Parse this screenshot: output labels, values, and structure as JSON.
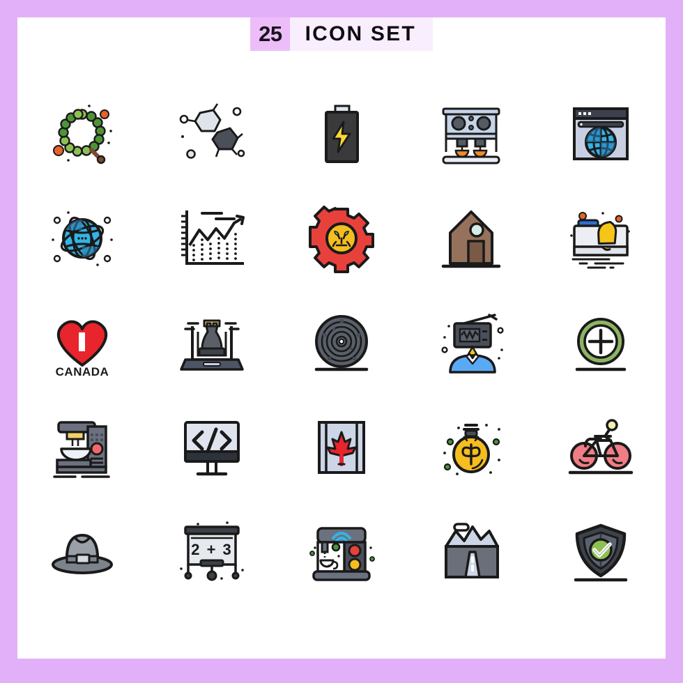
{
  "page": {
    "outer_background": "#e2b0f9",
    "sheet_background": "#ffffff"
  },
  "header": {
    "count": "25",
    "title": "ICON SET",
    "count_background": "#edbdfa",
    "title_background": "#f8eefd",
    "text_color": "#14101a"
  },
  "grid": {
    "columns": 5,
    "rows": 5,
    "total_icons": 25,
    "icons": [
      {
        "id": "prayer-beads",
        "label": "Prayer Beads",
        "row": 1,
        "col": 1,
        "colors": [
          "#4e9437",
          "#8cc152",
          "#e8622a",
          "#7a4a32"
        ]
      },
      {
        "id": "molecule",
        "label": "Molecule",
        "row": 1,
        "col": 2,
        "colors": [
          "#dfe4ea",
          "#4b5058",
          "#1a1a1a"
        ]
      },
      {
        "id": "battery-charging",
        "label": "Battery Charging",
        "row": 1,
        "col": 3,
        "colors": [
          "#3a3a3c",
          "#fbd734",
          "#dfe6f2"
        ]
      },
      {
        "id": "espresso-machine",
        "label": "Espresso Machine",
        "row": 1,
        "col": 4,
        "colors": [
          "#c6d4e8",
          "#555b63",
          "#f08b2a"
        ]
      },
      {
        "id": "web-browser-globe",
        "label": "Web Browser",
        "row": 1,
        "col": 5,
        "colors": [
          "#3c414d",
          "#c9cfe3",
          "#33b4e5",
          "#2a7fb8"
        ]
      },
      {
        "id": "global-network",
        "label": "Global Network",
        "row": 2,
        "col": 1,
        "colors": [
          "#33b4e5",
          "#2f79a8",
          "#1a1a1a"
        ]
      },
      {
        "id": "growth-chart",
        "label": "Growth Chart",
        "row": 2,
        "col": 2,
        "colors": [
          "#1a1a1a"
        ]
      },
      {
        "id": "settings-lion",
        "label": "Settings Gear",
        "row": 2,
        "col": 3,
        "colors": [
          "#e8413c",
          "#f5bd1f",
          "#8cc152"
        ]
      },
      {
        "id": "barn-house",
        "label": "Barn House",
        "row": 2,
        "col": 4,
        "colors": [
          "#96725c",
          "#7a5a46",
          "#d6ece8"
        ]
      },
      {
        "id": "notification-screen",
        "label": "Notification Alert",
        "row": 2,
        "col": 5,
        "colors": [
          "#2f6fd0",
          "#eceef3",
          "#f5c518",
          "#e8622a"
        ]
      },
      {
        "id": "i-love-canada",
        "label": "I Love Canada",
        "row": 3,
        "col": 1,
        "colors": [
          "#e8242c",
          "#1a1a1a"
        ]
      },
      {
        "id": "chess-laptop",
        "label": "Chess Strategy Laptop",
        "row": 3,
        "col": 2,
        "colors": [
          "#5a5f68",
          "#3e434c",
          "#f5d06a",
          "#4d5566"
        ]
      },
      {
        "id": "labyrinth-disc",
        "label": "Labyrinth Disc",
        "row": 3,
        "col": 3,
        "colors": [
          "#5a606a",
          "#464b54"
        ]
      },
      {
        "id": "radio-head-person",
        "label": "Radio Person",
        "row": 3,
        "col": 4,
        "colors": [
          "#4a4f59",
          "#5aa9f5",
          "#ffffff"
        ]
      },
      {
        "id": "add-circle",
        "label": "Add Circle",
        "row": 3,
        "col": 5,
        "colors": [
          "#8cb462",
          "#1a1a1a"
        ]
      },
      {
        "id": "stand-mixer",
        "label": "Stand Mixer",
        "row": 4,
        "col": 1,
        "colors": [
          "#6c717f",
          "#eef1f7",
          "#f5d06a",
          "#f4676b"
        ]
      },
      {
        "id": "code-monitor",
        "label": "Code Monitor",
        "row": 4,
        "col": 2,
        "colors": [
          "#dfe4ee",
          "#2e323a",
          "#1a1a1a"
        ]
      },
      {
        "id": "canada-flag",
        "label": "Canada Flag",
        "row": 4,
        "col": 3,
        "colors": [
          "#cdd6e6",
          "#e8242c",
          "#1a1a1a"
        ]
      },
      {
        "id": "idea-money-bulb",
        "label": "Money Idea Bulb",
        "row": 4,
        "col": 4,
        "colors": [
          "#f5bd1f",
          "#4e9437",
          "#1a1a1a"
        ]
      },
      {
        "id": "bicycle",
        "label": "Bicycle",
        "row": 4,
        "col": 5,
        "colors": [
          "#f07d85",
          "#f5eeb0",
          "#1a1a1a"
        ]
      },
      {
        "id": "fedora-hat",
        "label": "Fedora Hat",
        "row": 5,
        "col": 1,
        "colors": [
          "#9aa0a8",
          "#7d838c",
          "#d7dbe1"
        ]
      },
      {
        "id": "math-whiteboard",
        "label": "Math Whiteboard",
        "row": 5,
        "col": 2,
        "colors": [
          "#e6e9ee",
          "#3c4047",
          "#1a1a1a"
        ],
        "text": "2 + 3"
      },
      {
        "id": "smart-coffee-machine",
        "label": "Smart Coffee Machine",
        "row": 5,
        "col": 3,
        "colors": [
          "#6c717f",
          "#33b4e5",
          "#e8413c",
          "#f5bd1f",
          "#4e9437"
        ]
      },
      {
        "id": "mountain-tunnel",
        "label": "Mountain Tunnel",
        "row": 5,
        "col": 4,
        "colors": [
          "#cdd6e6",
          "#6a6f7a",
          "#1a1a1a"
        ]
      },
      {
        "id": "security-shield-check",
        "label": "Security Shield",
        "row": 5,
        "col": 5,
        "colors": [
          "#3d434b",
          "#5b6270",
          "#8cc152"
        ]
      }
    ]
  },
  "labels": {
    "canada_text": "CANADA",
    "canada_i": "I",
    "math_text": "2 + 3",
    "code_text": "</>"
  }
}
